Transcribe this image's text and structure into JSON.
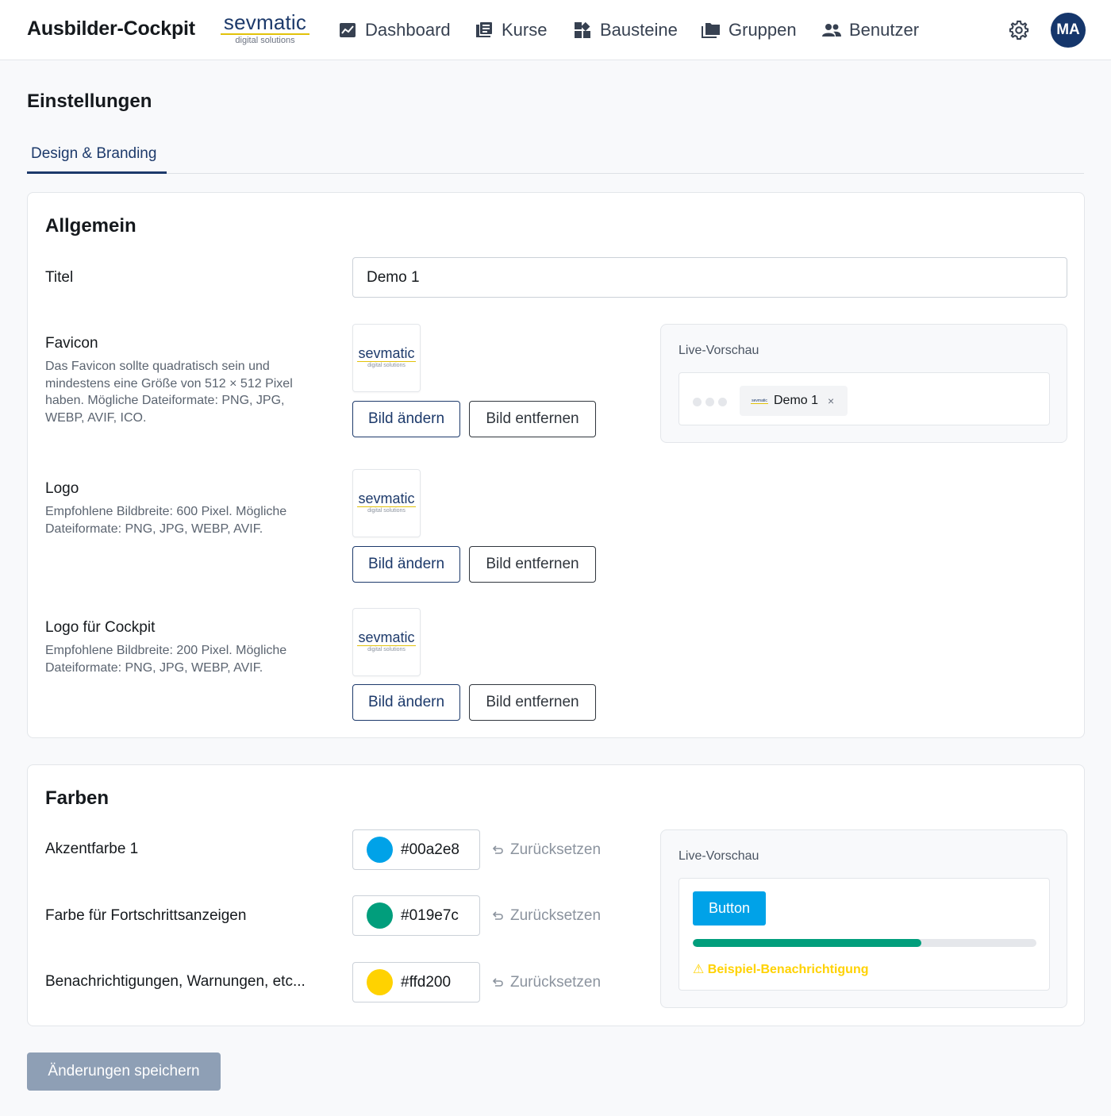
{
  "header": {
    "app_title": "Ausbilder-Cockpit",
    "brand": {
      "name": "sevmatic",
      "tagline": "digital solutions"
    },
    "nav": [
      {
        "label": "Dashboard",
        "icon": "chart-icon"
      },
      {
        "label": "Kurse",
        "icon": "book-icon"
      },
      {
        "label": "Bausteine",
        "icon": "blocks-icon"
      },
      {
        "label": "Gruppen",
        "icon": "folder-icon"
      },
      {
        "label": "Benutzer",
        "icon": "users-icon"
      }
    ],
    "settings_icon": "gear-icon",
    "avatar_initials": "MA"
  },
  "page": {
    "title": "Einstellungen",
    "tabs": [
      {
        "label": "Design & Branding",
        "active": true
      }
    ]
  },
  "general": {
    "heading": "Allgemein",
    "title_label": "Titel",
    "title_value": "Demo 1",
    "favicon": {
      "label": "Favicon",
      "help": "Das Favicon sollte quadratisch sein und mindestens eine Größe von 512 × 512 Pixel haben. Mögliche Dateiformate: PNG, JPG, WEBP, AVIF, ICO."
    },
    "logo": {
      "label": "Logo",
      "help": "Empfohlene Bildbreite: 600 Pixel. Mögliche Dateiformate: PNG, JPG, WEBP, AVIF."
    },
    "cockpit_logo": {
      "label": "Logo für Cockpit",
      "help": "Empfohlene Bildbreite: 200 Pixel. Mögliche Dateiformate: PNG, JPG, WEBP, AVIF."
    },
    "change_label": "Bild ändern",
    "remove_label": "Bild entfernen",
    "preview": {
      "label": "Live-Vorschau",
      "tab_title": "Demo 1",
      "close_glyph": "×"
    }
  },
  "colors": {
    "heading": "Farben",
    "reset_label": "Zurücksetzen",
    "items": [
      {
        "label": "Akzentfarbe 1",
        "value": "#00a2e8"
      },
      {
        "label": "Farbe für Fortschrittsanzeigen",
        "value": "#019e7c"
      },
      {
        "label": "Benachrichtigungen, Warnungen, etc...",
        "value": "#ffd200"
      }
    ],
    "preview": {
      "label": "Live-Vorschau",
      "button_label": "Button",
      "progress_fraction": 0.665,
      "notice_text": "⚠ Beispiel-Benachrichtigung"
    }
  },
  "save_label": "Änderungen speichern",
  "theme": {
    "primary": "#1d3a6b",
    "brand_yellow": "#e2c20a"
  }
}
